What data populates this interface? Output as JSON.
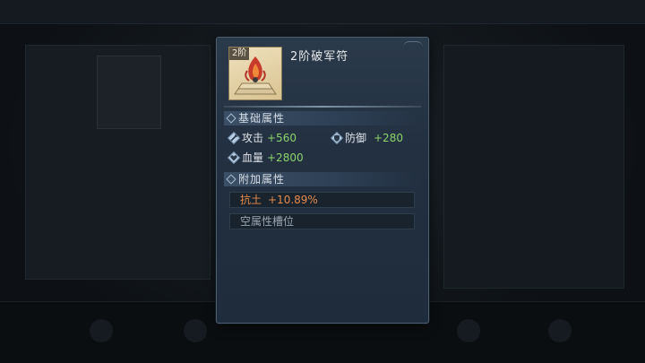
{
  "item": {
    "tier_badge": "2阶",
    "name": "2阶破军符",
    "icon": "talisman-icon"
  },
  "base_section": {
    "title": "基础属性",
    "stats": [
      {
        "icon": "attack-icon",
        "label": "攻击",
        "value": "+560"
      },
      {
        "icon": "defense-icon",
        "label": "防御",
        "value": "+280"
      },
      {
        "icon": "hp-icon",
        "label": "血量",
        "value": "+2800"
      }
    ]
  },
  "extra_section": {
    "title": "附加属性",
    "rows": [
      {
        "label": "抗土",
        "value": "+10.89%",
        "color": "#e58a4a"
      },
      {
        "label": "空属性槽位",
        "value": "",
        "color": "#9aa6b2"
      }
    ]
  },
  "colors": {
    "stat_value": "#8cd36a",
    "resist_earth": "#e58a4a",
    "empty_slot": "#9aa6b2"
  }
}
